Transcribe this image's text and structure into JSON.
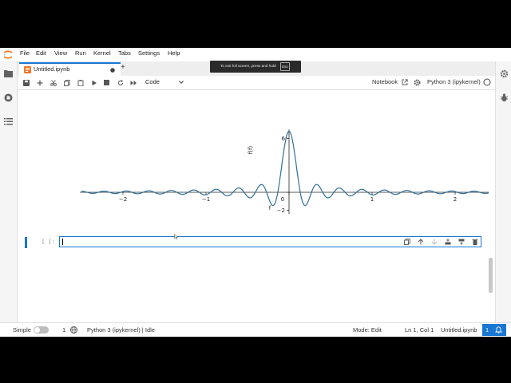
{
  "menu": [
    "File",
    "Edit",
    "View",
    "Run",
    "Kernel",
    "Tabs",
    "Settings",
    "Help"
  ],
  "tab": {
    "title": "Untitled.ipynb",
    "add_label": "+"
  },
  "toolbar": {
    "cell_type": "Code",
    "notebook_label": "Notebook",
    "kernel_label": "Python 3 (ipykernel)"
  },
  "tooltip": {
    "text": "To exit full screen, press and hold",
    "key": "Esc"
  },
  "cell": {
    "prompt": "[ ]:",
    "input_value": ""
  },
  "status": {
    "mode_label": "Simple",
    "terminals_count": "1",
    "kernel_status": "Python 3 (ipykernel) | Idle",
    "mode": "Mode: Edit",
    "cursor": "Ln 1, Col 1",
    "file": "Untitled.ipynb",
    "notifications": "1"
  },
  "colors": {
    "accent": "#1976d2",
    "plot_line": "#2d6f9a"
  },
  "chart_data": {
    "type": "line",
    "function": "sin(2πfx)/(πx)-style sinc curve (peak near 6.8 at x=0)",
    "ylabel": "f(f)",
    "xlabel": "f",
    "xticks": [
      "−2",
      "−1",
      "0",
      "1",
      "2"
    ],
    "yticks": [
      "6",
      "0",
      "−2"
    ],
    "xlim": [
      -2.5,
      2.5
    ],
    "ylim": [
      -2.4,
      7
    ],
    "series": [
      {
        "name": "",
        "x_range": [
          -2.5,
          2.5
        ],
        "peak": 6.8,
        "oscillation_freq": 3.7,
        "samples": 600
      }
    ]
  }
}
